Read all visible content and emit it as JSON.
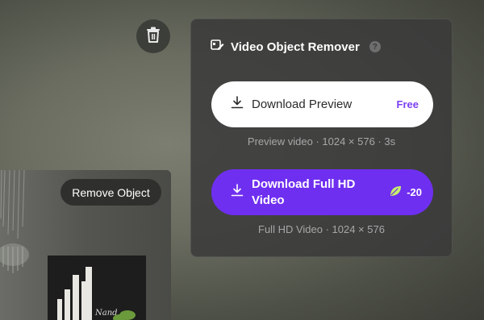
{
  "panel": {
    "title": "Video Object Remover",
    "help_icon": "?"
  },
  "download_preview": {
    "label": "Download Preview",
    "tag": "Free",
    "subtitle": "Preview video · 1024 × 576 · 3s"
  },
  "download_full": {
    "label": "Download Full HD Video",
    "cost": "-20",
    "subtitle": "Full HD Video · 1024 × 576"
  },
  "preview_chip": {
    "label": "Remove Object"
  },
  "icons": {
    "trash": "trash-icon",
    "remover": "object-remover-icon",
    "download": "download-icon",
    "leaf": "leaf-icon"
  },
  "colors": {
    "accent": "#6f2ff0",
    "free_tag": "#7b3ff2",
    "leaf": "#c6ee6d"
  }
}
